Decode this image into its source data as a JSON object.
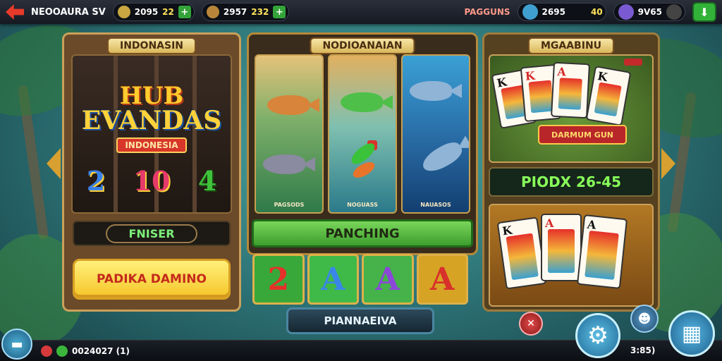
{
  "topbar": {
    "title": "NEOOAURA SV",
    "coins_label": "2095",
    "coins_value": "22",
    "gems_label": "2957",
    "gems_value": "232",
    "right_label": "PAGGUNS",
    "score_label": "2695",
    "score_value": "40",
    "level_label": "9V65"
  },
  "left_panel": {
    "title": "INDONASIN",
    "logo_line1": "HUB",
    "logo_line2": "EVANDAS",
    "logo_banner": "INDONESIA",
    "reel_1": "2",
    "reel_2": "10",
    "reel_3": "4",
    "label": "FNISER",
    "button": "PADIKA DAMINO"
  },
  "mid_panel": {
    "title": "NODIOANAIAN",
    "col_captions": [
      "PAGSODS",
      "NOGUASS",
      "NAUASOS"
    ],
    "button": "PANCHING",
    "tiles": [
      "2",
      "A",
      "A",
      "A"
    ],
    "bottom_button": "PIANNAEIVA"
  },
  "right_panel": {
    "title": "MGAABINU",
    "ribbon": "DARMUM GUN",
    "score": "PIODX 26-45",
    "card_ranks": [
      "K",
      "K",
      "A",
      "K"
    ],
    "bottom_card_ranks": [
      "K",
      "A",
      "A"
    ]
  },
  "bottombar": {
    "info": "0024027 (1)",
    "right_value": "3:85)"
  },
  "icons": {
    "gear": "⚙",
    "calendar": "▦",
    "plus": "+"
  }
}
